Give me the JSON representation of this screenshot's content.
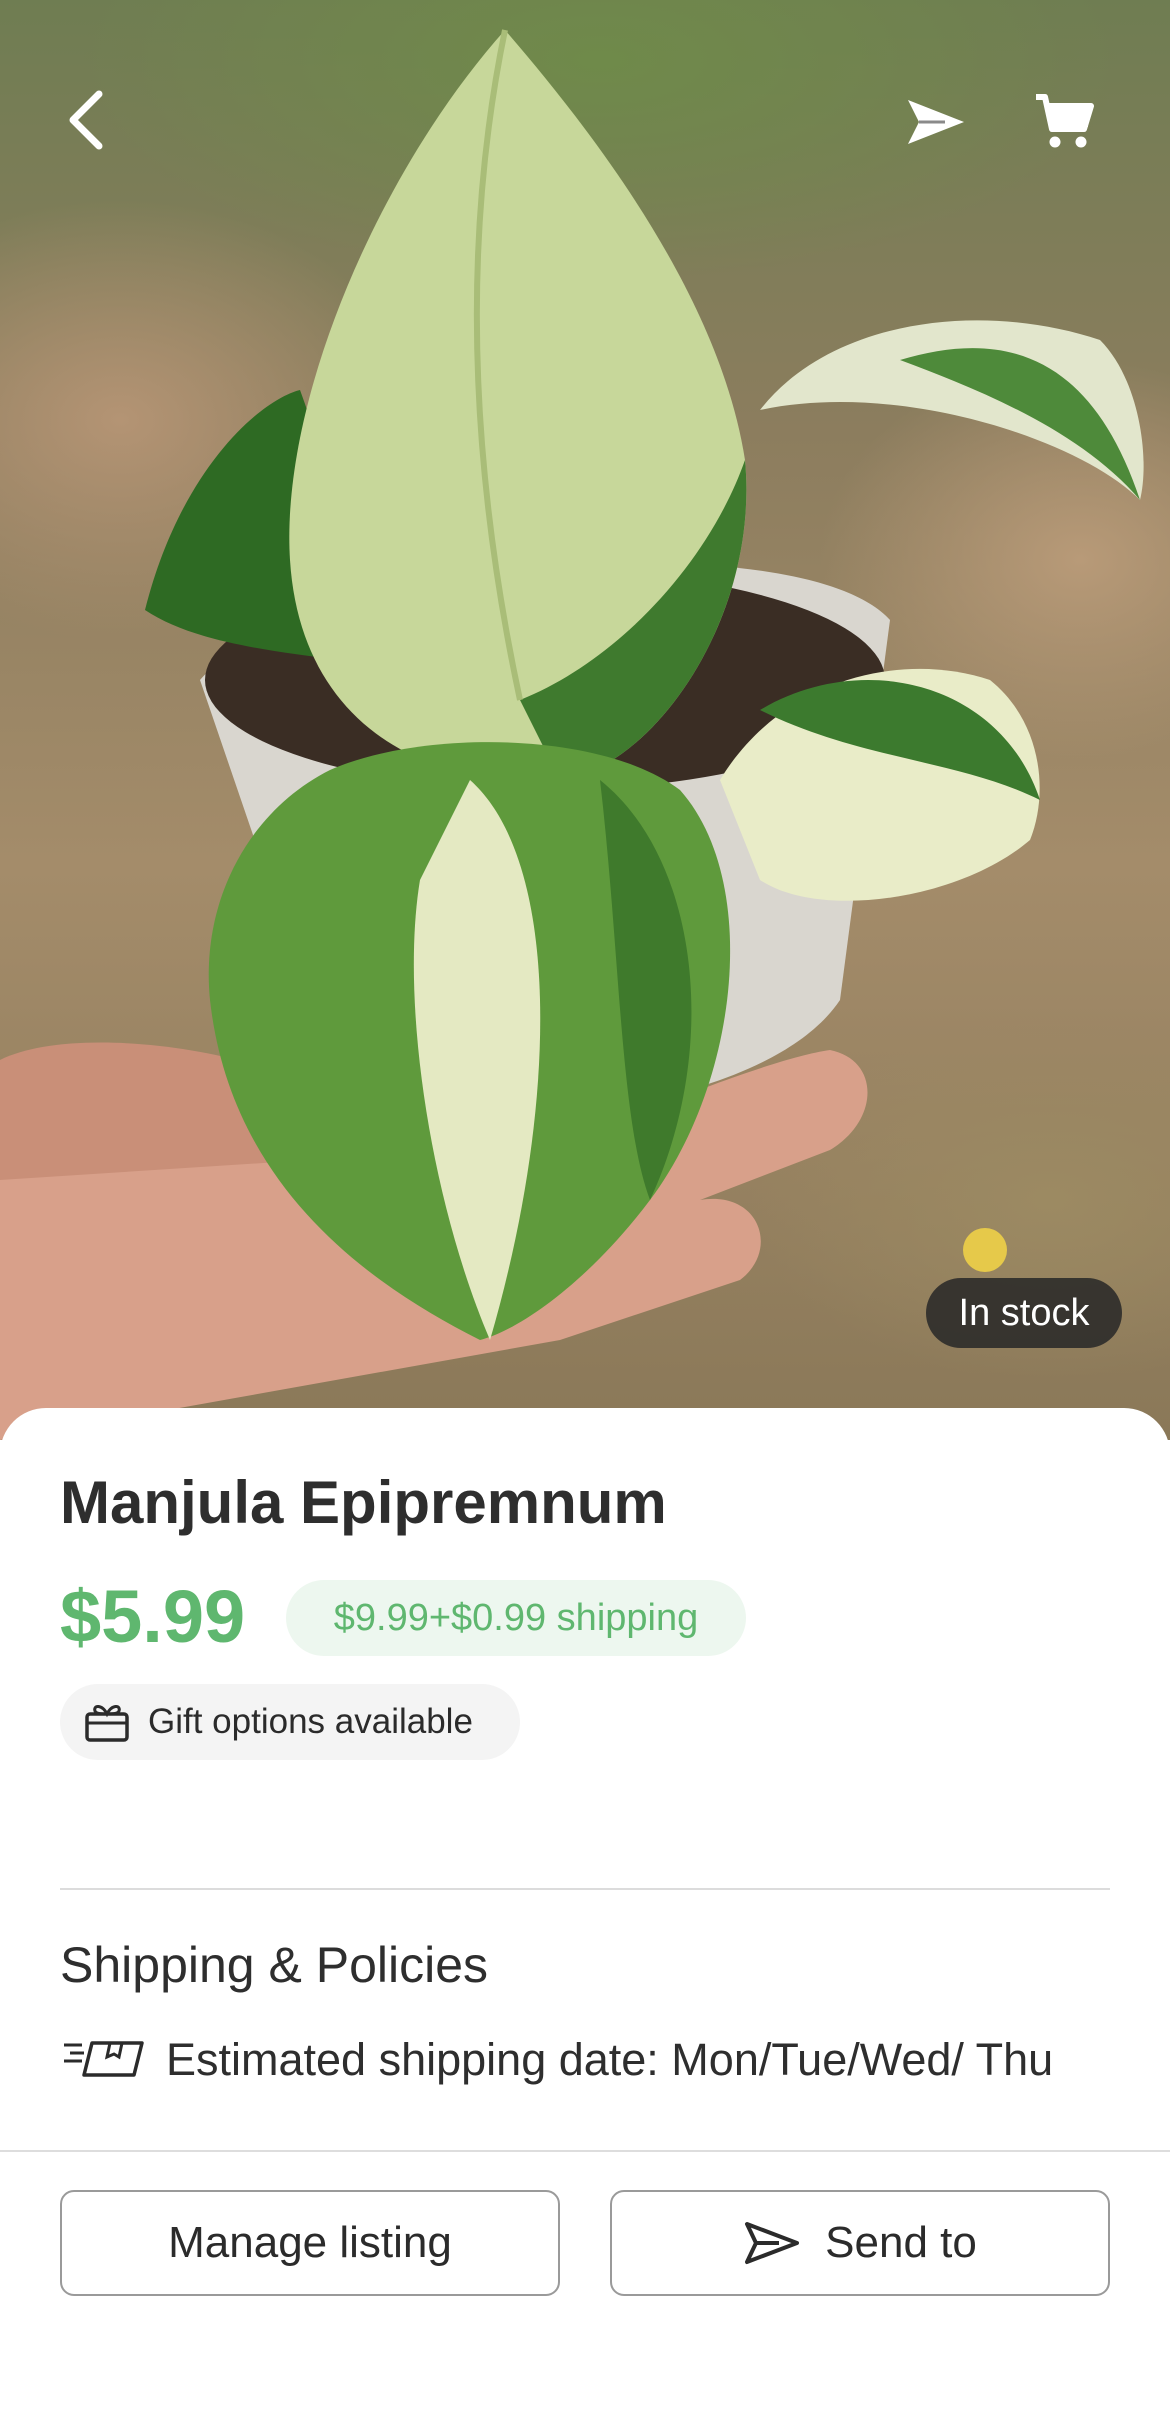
{
  "header": {
    "back_icon": "chevron-left-icon",
    "share_icon": "send-icon",
    "cart_icon": "cart-icon"
  },
  "hero": {
    "stock_badge": "In stock"
  },
  "product": {
    "title": "Manjula Epipremnum",
    "price": "$5.99",
    "original_price": "$9.99+$0.99 shipping",
    "gift_options": "Gift options available"
  },
  "shipping": {
    "section_title": "Shipping & Policies",
    "estimated_date": "Estimated shipping date: Mon/Tue/Wed/ Thu"
  },
  "actions": {
    "manage_label": "Manage listing",
    "send_label": "Send to"
  },
  "colors": {
    "accent": "#5fb76f",
    "pill_bg": "#edf7ef"
  }
}
